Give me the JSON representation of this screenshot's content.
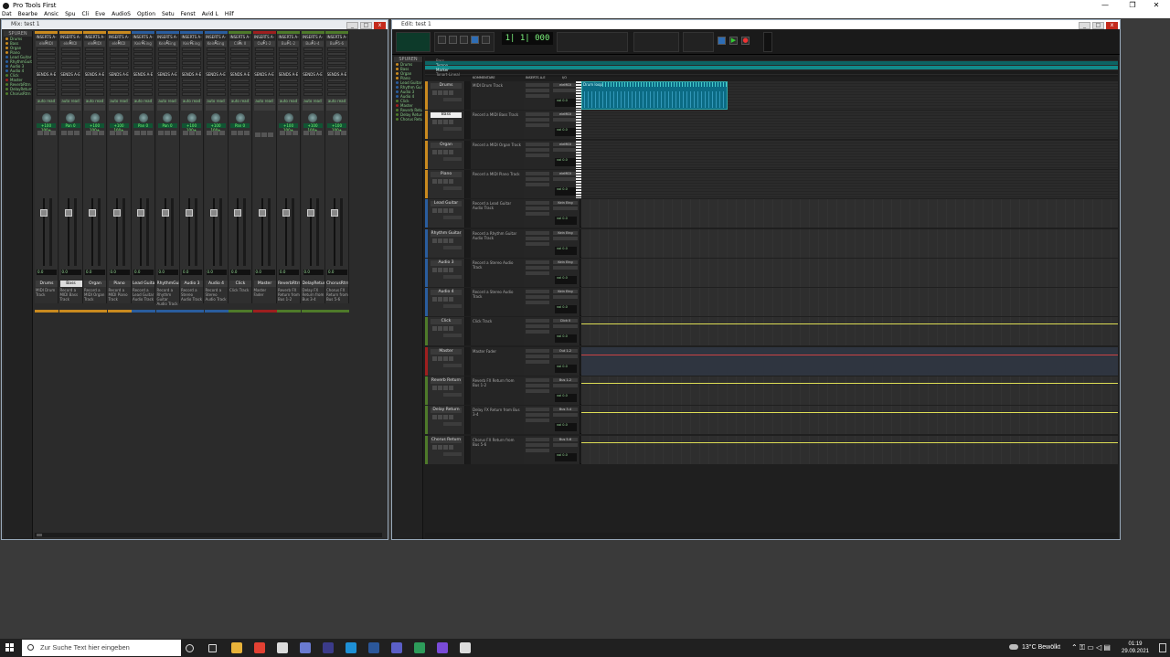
{
  "app": {
    "title": "Pro Tools First",
    "minimize": "—",
    "maximize": "❐",
    "close": "✕"
  },
  "menu": [
    "Dat",
    "Bearbe",
    "Ansic",
    "Spu",
    "Cli",
    "Eve",
    "AudioS",
    "Option",
    "Setu",
    "Fenst",
    "Avid L",
    "Hilf"
  ],
  "mix": {
    "title": "Mix: test 1",
    "tracklist_header": "SPUREN",
    "strips": [
      {
        "name": "Drums",
        "comment": "MIDI Drum Track",
        "color": "#c98a1f",
        "insert_a": "INSERTS A-E",
        "io": "eleMIDI",
        "vol": "0.0",
        "pan": "+100 100+",
        "selected": false
      },
      {
        "name": "Bass",
        "comment": "Record a MIDI Bass Track",
        "color": "#c98a1f",
        "insert_a": "INSERTS A-E",
        "io": "eleMIDI",
        "vol": "0.0",
        "pan": "Pan 0",
        "selected": true
      },
      {
        "name": "Organ",
        "comment": "Record a MIDI Organ Track",
        "color": "#c98a1f",
        "insert_a": "INSERTS A-E",
        "io": "eleMIDI",
        "vol": "0.0",
        "pan": "+100 100+",
        "selected": false
      },
      {
        "name": "Piano",
        "comment": "Record a MIDI Piano Track",
        "color": "#c98a1f",
        "insert_a": "INSERTS A-E",
        "io": "eleMIDI",
        "vol": "0.0",
        "pan": "+100 100+",
        "selected": false
      },
      {
        "name": "Lead Guitar",
        "comment": "Record a Lead Guitar Audio Track",
        "color": "#2a5d9e",
        "insert_a": "INSERTS A-E",
        "io": "Kein Eing",
        "vol": "0.0",
        "pan": "Pan 0",
        "selected": false
      },
      {
        "name": "RhythmGuit",
        "comment": "Record a Rhythm Guitar Audio Track",
        "color": "#2a5d9e",
        "insert_a": "INSERTS A-E",
        "io": "Kein Eing",
        "vol": "0.0",
        "pan": "Pan 0",
        "selected": false
      },
      {
        "name": "Audio 3",
        "comment": "Record a Stereo Audio Track",
        "color": "#2a5d9e",
        "insert_a": "INSERTS A-E",
        "io": "Kein Eing",
        "vol": "0.0",
        "pan": "+100 100+",
        "selected": false
      },
      {
        "name": "Audio 4",
        "comment": "Record a Stereo Audio Track",
        "color": "#2a5d9e",
        "insert_a": "INSERTS A-E",
        "io": "Kein Eing",
        "vol": "0.0",
        "pan": "+100 100+",
        "selected": false
      },
      {
        "name": "Click",
        "comment": "Click Track",
        "color": "#4e7a2a",
        "insert_a": "INSERTS A-E",
        "io": "Click II",
        "vol": "0.0",
        "pan": "Pan 0",
        "selected": false
      },
      {
        "name": "Master",
        "comment": "Master Fader",
        "color": "#9e1f1f",
        "insert_a": "INSERTS A-E",
        "io": "Out 1-2",
        "vol": "0.0",
        "pan": "",
        "selected": false
      },
      {
        "name": "ReverbRtrn",
        "comment": "Reverb FX Return from Bus 1-2",
        "color": "#4e7a2a",
        "insert_a": "INSERTS A-E",
        "io": "Bus 1-2",
        "vol": "0.0",
        "pan": "+100 100+",
        "selected": false
      },
      {
        "name": "DelayReturn",
        "comment": "Delay FX Return from Bus 3-4",
        "color": "#4e7a2a",
        "insert_a": "INSERTS A-E",
        "io": "Bus 3-4",
        "vol": "0.0",
        "pan": "+100 100+",
        "selected": false
      },
      {
        "name": "ChorusRtrn",
        "comment": "Chorus FX Return from Bus 5-6",
        "color": "#4e7a2a",
        "insert_a": "INSERTS A-E",
        "io": "Bus 5-6",
        "vol": "0.0",
        "pan": "+100 100+",
        "selected": false
      }
    ],
    "sends_label": "SENDS A-E",
    "auto_label": "auto read"
  },
  "edit": {
    "title": "Edit: test 1",
    "counter": "1| 1| 000",
    "tracklist_header": "SPUREN",
    "rulers": [
      "Bars",
      "Tempo",
      "Marker",
      "Tonart-Lineal"
    ],
    "col_comments": "KOMMENTARE",
    "col_inserts": "INSERTS A-E",
    "col_io": "I/O",
    "tracks": [
      {
        "name": "Drums",
        "comment": "MIDI Drum Track",
        "color": "#c98a1f",
        "io": "eleMIDI",
        "vol": "vol 0.0",
        "kind": "midi-clip",
        "clip": "Drum loop",
        "selected": false
      },
      {
        "name": "Bass",
        "comment": "Record a MIDI Bass Track",
        "color": "#c98a1f",
        "io": "eleMIDI",
        "vol": "vol 0.0",
        "kind": "midi",
        "selected": true
      },
      {
        "name": "Organ",
        "comment": "Record a MIDI Organ Track",
        "color": "#c98a1f",
        "io": "eleMIDI",
        "vol": "vol 0.0",
        "kind": "midi",
        "selected": false
      },
      {
        "name": "Piano",
        "comment": "Record a MIDI Piano Track",
        "color": "#c98a1f",
        "io": "eleMIDI",
        "vol": "vol 0.0",
        "kind": "midi",
        "selected": false
      },
      {
        "name": "Lead Guitar",
        "comment": "Record a Lead Guitar Audio Track",
        "color": "#2a5d9e",
        "io": "Kein Eing",
        "vol": "vol 0.0",
        "kind": "audio",
        "selected": false
      },
      {
        "name": "Rhythm Guitar",
        "comment": "Record a Rhythm Guitar Audio Track",
        "color": "#2a5d9e",
        "io": "Kein Eing",
        "vol": "vol 0.0",
        "kind": "audio",
        "selected": false
      },
      {
        "name": "Audio 3",
        "comment": "Record a Stereo Audio Track",
        "color": "#2a5d9e",
        "io": "Kein Eing",
        "vol": "vol 0.0",
        "kind": "audio",
        "selected": false
      },
      {
        "name": "Audio 4",
        "comment": "Record a Stereo Audio Track",
        "color": "#2a5d9e",
        "io": "Kein Eing",
        "vol": "vol 0.0",
        "kind": "audio",
        "selected": false
      },
      {
        "name": "Click",
        "comment": "Click Track",
        "color": "#4e7a2a",
        "io": "Click II",
        "vol": "vol 0.0",
        "kind": "vol",
        "selected": false
      },
      {
        "name": "Master",
        "comment": "Master Fader",
        "color": "#9e1f1f",
        "io": "Out 1-2",
        "vol": "vol 0.0",
        "kind": "master",
        "selected": false
      },
      {
        "name": "Reverb Return",
        "comment": "Reverb FX Return from Bus 1-2",
        "color": "#4e7a2a",
        "io": "Bus 1-2",
        "vol": "vol 0.0",
        "kind": "vol",
        "selected": false
      },
      {
        "name": "Delay Return",
        "comment": "Delay FX Return from Bus 3-4",
        "color": "#4e7a2a",
        "io": "Bus 3-4",
        "vol": "vol 0.0",
        "kind": "vol",
        "selected": false
      },
      {
        "name": "Chorus Return",
        "comment": "Chorus FX Return from Bus 5-6",
        "color": "#4e7a2a",
        "io": "Bus 5-6",
        "vol": "vol 0.0",
        "kind": "vol",
        "selected": false
      }
    ]
  },
  "taskbar": {
    "search_placeholder": "Zur Suche Text hier eingeben",
    "weather": "13°C  Bewölkt",
    "time": "01:19",
    "date": "29.09.2021",
    "icons": [
      "cortana-icon",
      "task-view-icon",
      "explorer-icon",
      "chrome-icon",
      "media-icon",
      "calculator-icon",
      "obs-icon",
      "skype-icon",
      "word-icon",
      "teams-icon",
      "pycharm-icon",
      "protools-icon",
      "settings-icon"
    ]
  }
}
